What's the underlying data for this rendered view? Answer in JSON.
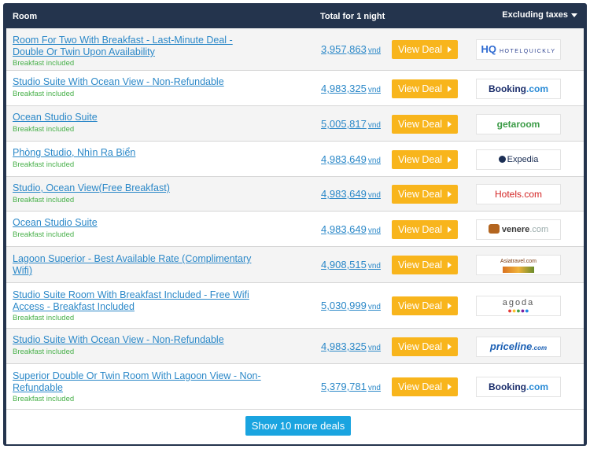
{
  "header": {
    "room": "Room",
    "total": "Total for 1 night",
    "taxes": "Excluding taxes"
  },
  "deals": [
    {
      "title": "Room For Two With Breakfast - Last-Minute Deal - Double Or Twin Upon Availability",
      "note": "Breakfast included",
      "price": "3,957,863",
      "unit": "vnd",
      "button": "View Deal",
      "provider": "HOTELQUICKLY",
      "provider_mark": "HQ",
      "logo_style": "hq"
    },
    {
      "title": "Studio Suite With Ocean View - Non-Refundable",
      "note": "Breakfast included",
      "price": "4,983,325",
      "unit": "vnd",
      "button": "View Deal",
      "provider": "Booking",
      "provider_suffix": ".com",
      "logo_style": "booking"
    },
    {
      "title": "Ocean Studio Suite",
      "note": "Breakfast included",
      "price": "5,005,817",
      "unit": "vnd",
      "button": "View Deal",
      "provider": "getaroom",
      "logo_style": "getaroom"
    },
    {
      "title": "Phòng Studio, Nhìn Ra Biển",
      "note": "Breakfast included",
      "price": "4,983,649",
      "unit": "vnd",
      "button": "View Deal",
      "provider": "Expedia",
      "logo_style": "expedia"
    },
    {
      "title": "Studio, Ocean View(Free Breakfast)",
      "note": "Breakfast included",
      "price": "4,983,649",
      "unit": "vnd",
      "button": "View Deal",
      "provider": "Hotels.com",
      "logo_style": "hotels"
    },
    {
      "title": "Ocean Studio Suite",
      "note": "Breakfast included",
      "price": "4,983,649",
      "unit": "vnd",
      "button": "View Deal",
      "provider": "venere",
      "provider_suffix": ".com",
      "logo_style": "venere"
    },
    {
      "title": "Lagoon Superior - Best Available Rate (Complimentary Wifi)",
      "note": "",
      "price": "4,908,515",
      "unit": "vnd",
      "button": "View Deal",
      "provider": "Asiatravel.com",
      "logo_style": "asia"
    },
    {
      "title": "Studio Suite Room With Breakfast Included - Free Wifi Access - Breakfast Included",
      "note": "Breakfast included",
      "price": "5,030,999",
      "unit": "vnd",
      "button": "View Deal",
      "provider": "agoda",
      "logo_style": "agoda"
    },
    {
      "title": "Studio Suite With Ocean View - Non-Refundable",
      "note": "Breakfast included",
      "price": "4,983,325",
      "unit": "vnd",
      "button": "View Deal",
      "provider": "priceline",
      "provider_suffix": ".com",
      "logo_style": "priceline"
    },
    {
      "title": "Superior Double Or Twin Room With Lagoon View - Non-Refundable",
      "note": "Breakfast included",
      "price": "5,379,781",
      "unit": "vnd",
      "button": "View Deal",
      "provider": "Booking",
      "provider_suffix": ".com",
      "logo_style": "booking"
    }
  ],
  "footer": {
    "more_button": "Show 10 more deals"
  },
  "colors": {
    "frame": "#24344d",
    "link": "#2b88c8",
    "deal_button": "#f8b51c",
    "breakfast": "#48b04a",
    "more_button": "#1aa4e0"
  }
}
